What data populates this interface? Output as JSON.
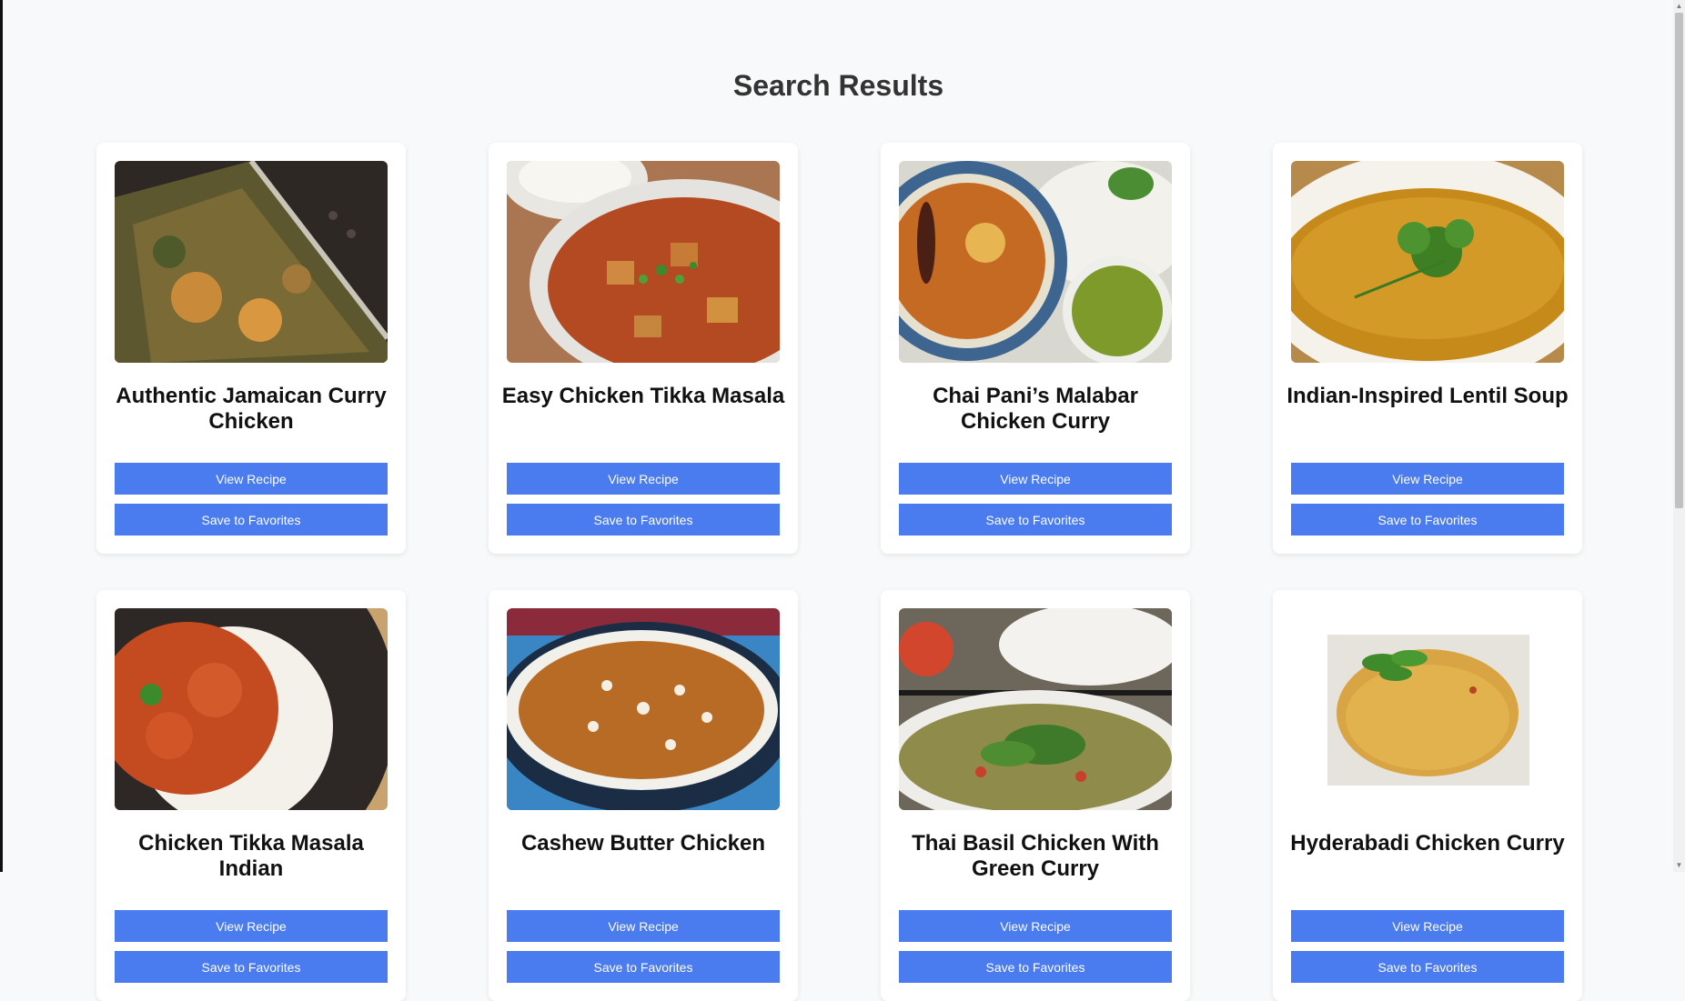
{
  "page": {
    "heading": "Search Results"
  },
  "recipes": [
    {
      "title": "Authentic Jamaican Curry Chicken",
      "view_label": "View Recipe",
      "save_label": "Save to Favorites"
    },
    {
      "title": "Easy Chicken Tikka Masala",
      "view_label": "View Recipe",
      "save_label": "Save to Favorites"
    },
    {
      "title": "Chai Pani’s Malabar Chicken Curry",
      "view_label": "View Recipe",
      "save_label": "Save to Favorites"
    },
    {
      "title": "Indian-Inspired Lentil Soup",
      "view_label": "View Recipe",
      "save_label": "Save to Favorites"
    },
    {
      "title": "Chicken Tikka Masala Indian",
      "view_label": "View Recipe",
      "save_label": "Save to Favorites"
    },
    {
      "title": "Cashew Butter Chicken",
      "view_label": "View Recipe",
      "save_label": "Save to Favorites"
    },
    {
      "title": "Thai Basil Chicken With Green Curry",
      "view_label": "View Recipe",
      "save_label": "Save to Favorites"
    },
    {
      "title": "Hyderabadi Chicken Curry",
      "view_label": "View Recipe",
      "save_label": "Save to Favorites"
    }
  ],
  "colors": {
    "accent": "#4a7bef",
    "background": "#f8f9fa",
    "card": "#ffffff"
  }
}
